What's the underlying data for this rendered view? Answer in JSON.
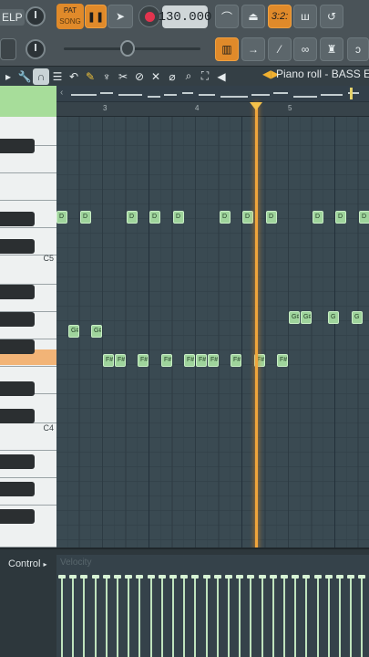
{
  "toolbar": {
    "left_label": "ELP",
    "pattern_label": "PAT",
    "song_label": "SONG",
    "tempo": "130.000",
    "time_readout": "3:2:",
    "icons": [
      "knob-icon",
      "pause-icon",
      "cursor-icon",
      "record-icon",
      "tempo-icon",
      "metronome-icon",
      "wait-icon",
      "countdown-icon",
      "snap-icon",
      "loop-icon"
    ]
  },
  "tools": {
    "icons": [
      "arrow-icon",
      "wrench-icon",
      "magnet-icon",
      "menu-icon",
      "undo-icon",
      "pencil-icon",
      "brush-icon",
      "cross-brush-icon",
      "delete-icon",
      "mute-icon",
      "slice-icon",
      "zoom-icon",
      "select-icon",
      "speaker-icon"
    ],
    "window_title": "Piano roll - BASS E"
  },
  "ruler": {
    "bars": [
      "3",
      "4",
      "5"
    ]
  },
  "keyboard": {
    "octaves": [
      "C5",
      "C4"
    ]
  },
  "notes": [
    {
      "label": "D",
      "col": 0,
      "row": 0
    },
    {
      "label": "D",
      "col": 1,
      "row": 0
    },
    {
      "label": "D",
      "col": 3,
      "row": 0
    },
    {
      "label": "D",
      "col": 4,
      "row": 0
    },
    {
      "label": "D",
      "col": 5,
      "row": 0
    },
    {
      "label": "D",
      "col": 7,
      "row": 0
    },
    {
      "label": "D",
      "col": 8,
      "row": 0
    },
    {
      "label": "D",
      "col": 9,
      "row": 0
    },
    {
      "label": "D",
      "col": 11,
      "row": 0
    },
    {
      "label": "D",
      "col": 12,
      "row": 0
    },
    {
      "label": "D",
      "col": 13,
      "row": 0
    },
    {
      "label": "G#",
      "col": 10,
      "row": 1
    },
    {
      "label": "G#",
      "col": 10.5,
      "row": 1
    },
    {
      "label": "G",
      "col": 11.7,
      "row": 1
    },
    {
      "label": "G",
      "col": 12.7,
      "row": 1
    },
    {
      "label": "G",
      "col": 13.6,
      "row": 1
    },
    {
      "label": "G#",
      "col": 0.5,
      "row": 2
    },
    {
      "label": "G#",
      "col": 1.5,
      "row": 2
    },
    {
      "label": "F#",
      "col": 2,
      "row": 3
    },
    {
      "label": "F#",
      "col": 2.5,
      "row": 3
    },
    {
      "label": "F#",
      "col": 3.5,
      "row": 3
    },
    {
      "label": "F#",
      "col": 4.5,
      "row": 3
    },
    {
      "label": "F#",
      "col": 5.5,
      "row": 3
    },
    {
      "label": "F#",
      "col": 6,
      "row": 3
    },
    {
      "label": "F#",
      "col": 6.5,
      "row": 3
    },
    {
      "label": "F#",
      "col": 7.5,
      "row": 3
    },
    {
      "label": "F#",
      "col": 8.5,
      "row": 3
    },
    {
      "label": "F#",
      "col": 9.5,
      "row": 3
    }
  ],
  "control": {
    "label": "Control",
    "parameter": "Velocity"
  },
  "colors": {
    "accent": "#e08a2a",
    "note": "#9fd49c",
    "playhead": "#f0a53c",
    "record": "#e2344e"
  }
}
